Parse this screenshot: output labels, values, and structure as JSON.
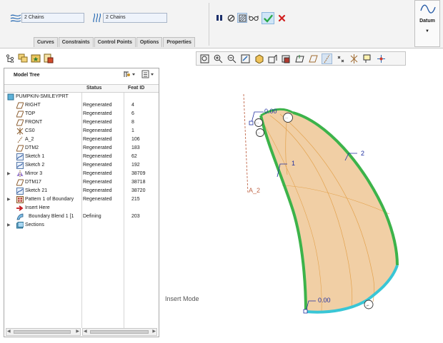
{
  "dashboard": {
    "chain_field_1": "2 Chains",
    "chain_field_2": "2 Chains",
    "tabs": [
      "Curves",
      "Constraints",
      "Control Points",
      "Options",
      "Properties"
    ],
    "controls": [
      "pause-icon",
      "stop-icon",
      "preview-icon",
      "glasses-icon",
      "ok-icon",
      "cancel-icon"
    ],
    "datum_label": "Datum",
    "accent_ok": "#2ba84a",
    "accent_cancel": "#d11f1f"
  },
  "tree": {
    "title": "Model Tree",
    "columns": {
      "status": "Status",
      "feat_id": "Feat ID"
    },
    "root": "PUMPKIN-SMILEYPRT",
    "items": [
      {
        "name": "RIGHT",
        "status": "Regenerated",
        "id": "4",
        "icon": "datum-plane-icon"
      },
      {
        "name": "TOP",
        "status": "Regenerated",
        "id": "6",
        "icon": "datum-plane-icon"
      },
      {
        "name": "FRONT",
        "status": "Regenerated",
        "id": "8",
        "icon": "datum-plane-icon"
      },
      {
        "name": "CS0",
        "status": "Regenerated",
        "id": "1",
        "icon": "csys-icon"
      },
      {
        "name": "A_2",
        "status": "Regenerated",
        "id": "106",
        "icon": "datum-axis-icon"
      },
      {
        "name": "DTM2",
        "status": "Regenerated",
        "id": "183",
        "icon": "datum-plane-icon"
      },
      {
        "name": "Sketch 1",
        "status": "Regenerated",
        "id": "62",
        "icon": "sketch-icon"
      },
      {
        "name": "Sketch 2",
        "status": "Regenerated",
        "id": "192",
        "icon": "sketch-icon"
      },
      {
        "name": "Mirror 3",
        "status": "Regenerated",
        "id": "38709",
        "icon": "mirror-icon"
      },
      {
        "name": "DTM17",
        "status": "Regenerated",
        "id": "38718",
        "icon": "datum-plane-icon"
      },
      {
        "name": "Sketch 21",
        "status": "Regenerated",
        "id": "38720",
        "icon": "sketch-icon"
      },
      {
        "name": "Pattern 1 of Boundary",
        "status": "Regenerated",
        "id": "215",
        "icon": "pattern-icon"
      },
      {
        "name": "Insert Here",
        "status": "",
        "id": "",
        "icon": "insert-arrow-icon"
      },
      {
        "name": "Boundary Blend 1 [1",
        "status": "Defining",
        "id": "203",
        "icon": "boundary-blend-icon"
      },
      {
        "name": "Sections",
        "status": "",
        "id": "",
        "icon": "sections-icon"
      }
    ]
  },
  "graphics": {
    "insert_mode": "Insert Mode",
    "labels": {
      "top_value": "0.00",
      "bottom_value": "0.00",
      "chain_1": "1",
      "chain_2": "2",
      "axis": "A_2"
    },
    "colors": {
      "surface": "#f1cfa5",
      "edge_green": "#3cb34a",
      "edge_cyan": "#39c6d6",
      "inner_lines": "#e3a24d",
      "dims": "#1f2fa0",
      "axis": "#c0674a"
    }
  }
}
